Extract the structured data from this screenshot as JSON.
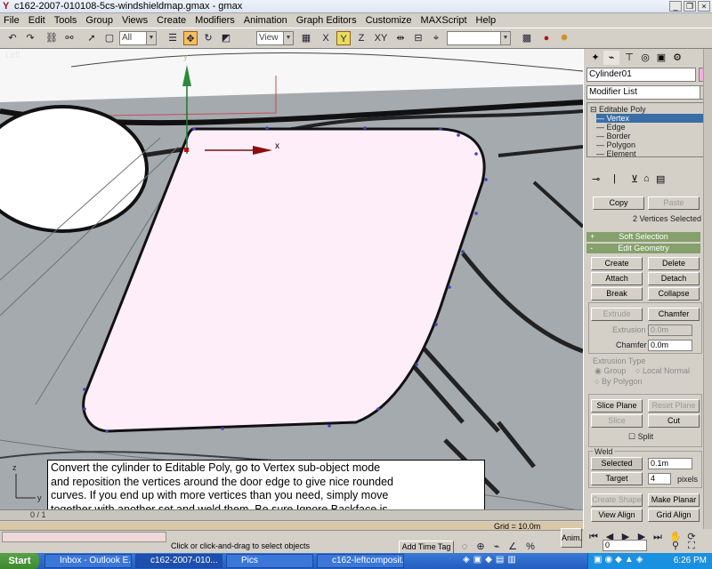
{
  "window": {
    "title": "c162-2007-010108-5cs-windshieldmap.gmax - gmax",
    "controls": [
      "_",
      "❐",
      "×"
    ]
  },
  "menu": [
    "File",
    "Edit",
    "Tools",
    "Group",
    "Views",
    "Create",
    "Modifiers",
    "Animation",
    "Graph Editors",
    "Customize",
    "MAXScript",
    "Help"
  ],
  "toolbar": {
    "selection_filter": "All",
    "ref_coord": "View",
    "named_sel": "",
    "axis_x": "X",
    "axis_y": "Y",
    "axis_z": "Z",
    "axis_xy": "XY"
  },
  "viewport": {
    "label": "Left",
    "gizmo_y": "y",
    "gizmo_x": "x",
    "instructions": "Convert the cylinder to Editable Poly, go to Vertex sub-object mode\nand reposition the vertices around the door edge to give nice rounded\ncurves.  If you end up with more vertices than you need, simply move\ntogether with another set and weld them.  Be sure Ignore Backface is\nNOT checked.",
    "shape_color": "#fdeefa"
  },
  "command_panel": {
    "object_name": "Cylinder01",
    "object_color": "#f2b0e0",
    "modifier_list": "Modifier List",
    "stack": {
      "root": "Editable Poly",
      "items": [
        "Vertex",
        "Edge",
        "Border",
        "Polygon",
        "Element"
      ],
      "selected": "Vertex"
    },
    "selection_status": "2 Vertices Selected",
    "copy_label": "Copy",
    "paste_label": "Paste",
    "soft_selection": "Soft Selection",
    "edit_geometry": "Edit Geometry",
    "buttons": {
      "create": "Create",
      "delete": "Delete",
      "attach": "Attach",
      "detach": "Detach",
      "break": "Break",
      "collapse": "Collapse",
      "extrude": "Extrude",
      "chamfer": "Chamfer",
      "slice_plane": "Slice Plane",
      "reset_plane": "Reset Plane",
      "slice": "Slice",
      "cut": "Cut",
      "selected": "Selected",
      "target": "Target",
      "create_shape": "Create Shape",
      "make_planar": "Make Planar",
      "view_align": "View Align",
      "grid_align": "Grid Align"
    },
    "extrusion_label": "Extrusion",
    "extrusion_value": "0.0m",
    "chamfer_label": "Chamfer",
    "chamfer_value": "0.0m",
    "extrusion_type": "Extrusion Type",
    "group_label": "Group",
    "local_normal": "Local Normal",
    "by_polygon": "By Polygon",
    "split_label": "Split",
    "weld_label": "Weld",
    "weld_value": "0.1m",
    "target_value": "4",
    "pixels_label": "pixels"
  },
  "status": {
    "timeline": "0 / 1",
    "grid": "Grid = 10.0m",
    "prompt": "Click or click-and-drag to select objects",
    "add_time_tag": "Add Time Tag",
    "anim": "Anim.",
    "frame": "0"
  },
  "taskbar": {
    "start": "Start",
    "tasks": [
      "Inbox - Outlook E...",
      "c162-2007-010...",
      "Pics",
      "c162-leftcomposit..."
    ],
    "clock": "6:26 PM"
  }
}
